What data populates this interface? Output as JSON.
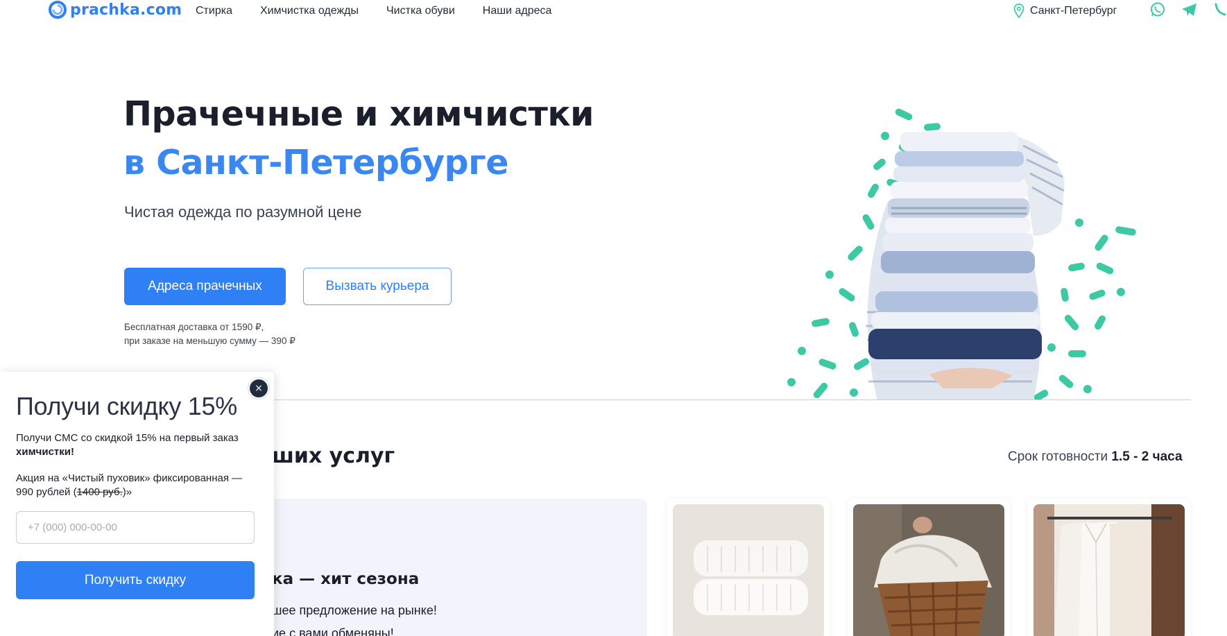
{
  "header": {
    "logo_text": "prachka.com",
    "nav": [
      {
        "label": "Стирка"
      },
      {
        "label": "Химчистка одежды"
      },
      {
        "label": "Чистка обуви"
      },
      {
        "label": "Наши адреса"
      }
    ],
    "city": "Санкт-Петербург",
    "social_icons": [
      "whatsapp-icon",
      "telegram-icon",
      "viber-icon"
    ]
  },
  "hero": {
    "title_line1": "Прачечные и химчистки",
    "title_line2": "в Санкт-Петербурге",
    "subtitle": "Чистая одежда по разумной цене",
    "btn_addresses": "Адреса прачечных",
    "btn_courier": "Вызвать курьера",
    "delivery_line1": "Бесплатная доставка от 1590 ₽,",
    "delivery_line2": "при заказе на меньшую сумму — 390 ₽",
    "image_desc": "stack-of-folded-clothes"
  },
  "services": {
    "title_partial": "ших услуг",
    "ready_label": "Срок готовности",
    "ready_value": "1.5 - 2 часа",
    "promo_title_partial": "ка — хит сезона",
    "promo_text_partial": "шее предложение на рынке!",
    "promo_text2_partial": "ие с вами обменяны!"
  },
  "popup": {
    "close": "×",
    "title": "Получи скидку 15%",
    "text1_plain": "Получи СМС со скидкой 15% на первый заказ",
    "text1_bold": "химчистки!",
    "text2_a": "Акция на «Чистый пуховик» фиксированная — 990 рублей (",
    "text2_strike": "1400 руб.",
    "text2_b": ")»",
    "phone_placeholder": "+7 (000) 000-00-00",
    "submit": "Получить скидку"
  },
  "colors": {
    "accent": "#2f7ff5",
    "title_blue": "#3a87f2",
    "teal_dots": "#3ec9a5",
    "dark": "#1a1f2b"
  }
}
